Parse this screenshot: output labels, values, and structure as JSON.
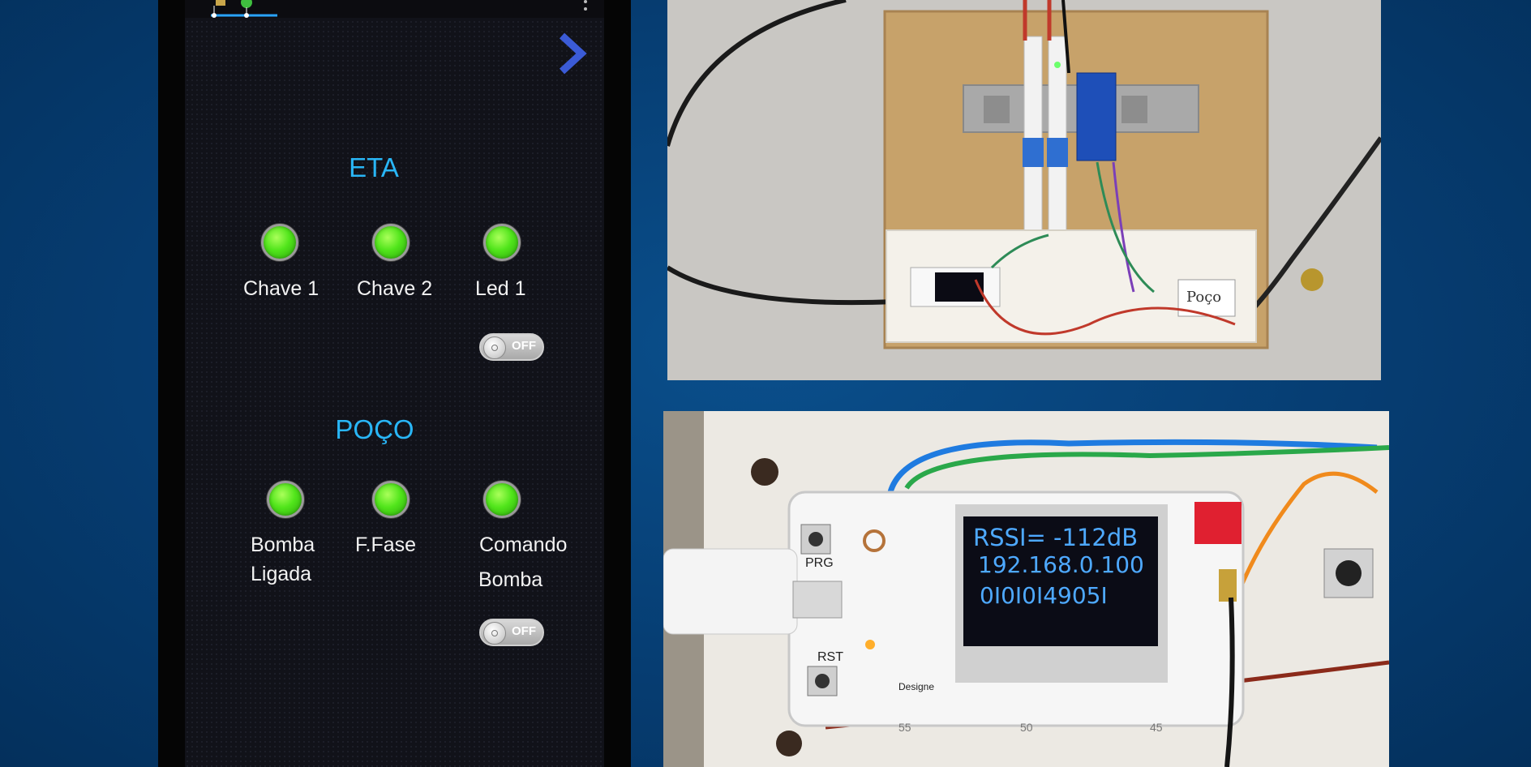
{
  "app": {
    "sections": [
      {
        "title": "ETA",
        "indicators": [
          {
            "label": "Chave 1"
          },
          {
            "label": "Chave 2"
          },
          {
            "label": "Led 1"
          }
        ],
        "toggle": {
          "label": "OFF",
          "state": "off"
        }
      },
      {
        "title": "POÇO",
        "indicators": [
          {
            "label_line1": "Bomba",
            "label_line2": "Ligada"
          },
          {
            "label": "F.Fase"
          },
          {
            "label_line1": "Comando",
            "label_line2": "Bomba"
          }
        ],
        "toggle": {
          "label": "OFF",
          "state": "off"
        }
      }
    ],
    "led_color": "#51e51b",
    "title_color": "#29b6f6",
    "icons": [
      "app-logo-icon",
      "more-vert-icon",
      "chevron-right-icon"
    ]
  },
  "photos": {
    "top": {
      "board_label": "Poço"
    },
    "bottom": {
      "oled_lines": [
        "RSSI= -112dB",
        "192.168.0.100",
        "0I0I0I4905I"
      ],
      "silkscreen": {
        "prg": "PRG",
        "rst": "RST",
        "design": "Designe"
      },
      "breadboard_numbers": [
        "55",
        "50",
        "45"
      ]
    }
  }
}
